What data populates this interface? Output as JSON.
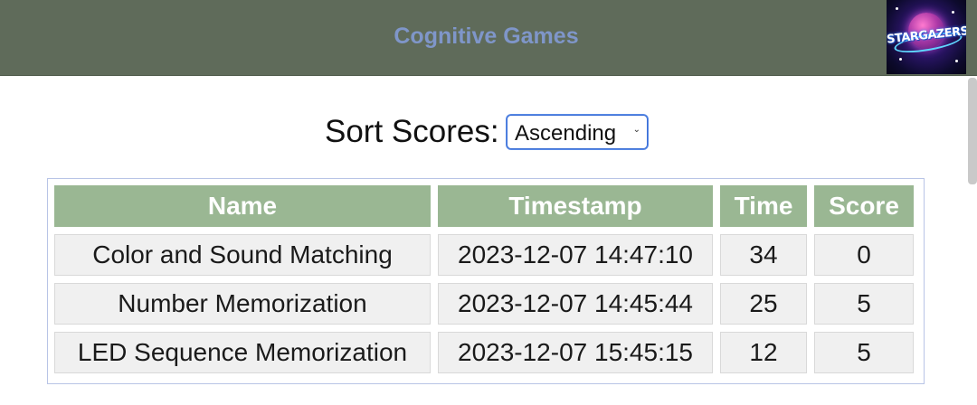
{
  "header": {
    "title": "Cognitive Games",
    "logo_text": "STARGAZERS",
    "background_color": "#5f6b5a",
    "title_color": "#7f96c9"
  },
  "sort": {
    "label": "Sort Scores:",
    "selected": "Ascending"
  },
  "table": {
    "columns": [
      "Name",
      "Timestamp",
      "Time",
      "Score"
    ],
    "header_color": "#9ab793",
    "rows": [
      {
        "name": "Color and Sound Matching",
        "timestamp": "2023-12-07 14:47:10",
        "time": "34",
        "score": "0"
      },
      {
        "name": "Number Memorization",
        "timestamp": "2023-12-07 14:45:44",
        "time": "25",
        "score": "5"
      },
      {
        "name": "LED Sequence Memorization",
        "timestamp": "2023-12-07 15:45:15",
        "time": "12",
        "score": "5"
      }
    ]
  }
}
